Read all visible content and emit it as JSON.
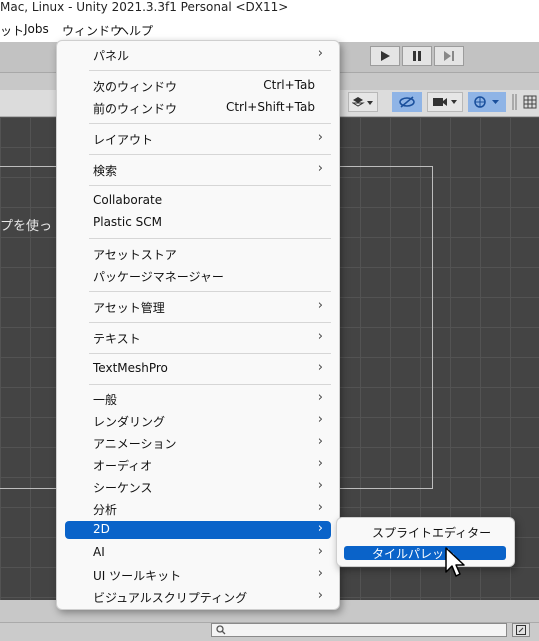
{
  "window": {
    "title": "Mac, Linux - Unity 2021.3.3f1 Personal <DX11>"
  },
  "menubar": {
    "items": [
      {
        "label": "ット"
      },
      {
        "label": "Jobs"
      },
      {
        "label": "ウィンドウ"
      },
      {
        "label": "ヘルプ"
      }
    ]
  },
  "scene": {
    "overlay_text": "プを使っ"
  },
  "window_menu": {
    "items": [
      {
        "label": "パネル",
        "arrow": "›"
      },
      {
        "label": "次のウィンドウ",
        "shortcut": "Ctrl+Tab"
      },
      {
        "label": "前のウィンドウ",
        "shortcut": "Ctrl+Shift+Tab"
      },
      {
        "label": "レイアウト",
        "arrow": "›"
      },
      {
        "label": "検索",
        "arrow": "›"
      },
      {
        "label": "Collaborate"
      },
      {
        "label": "Plastic SCM"
      },
      {
        "label": "アセットストア"
      },
      {
        "label": "パッケージマネージャー"
      },
      {
        "label": "アセット管理",
        "arrow": "›"
      },
      {
        "label": "テキスト",
        "arrow": "›"
      },
      {
        "label": "TextMeshPro",
        "arrow": "›"
      },
      {
        "label": "一般",
        "arrow": "›"
      },
      {
        "label": "レンダリング",
        "arrow": "›"
      },
      {
        "label": "アニメーション",
        "arrow": "›"
      },
      {
        "label": "オーディオ",
        "arrow": "›"
      },
      {
        "label": "シーケンス",
        "arrow": "›"
      },
      {
        "label": "分析",
        "arrow": "›"
      },
      {
        "label": "2D",
        "arrow": "›"
      },
      {
        "label": "AI",
        "arrow": "›"
      },
      {
        "label": "UI ツールキット",
        "arrow": "›"
      },
      {
        "label": "ビジュアルスクリプティング",
        "arrow": "›"
      }
    ],
    "selected": "2D"
  },
  "submenu_2d": {
    "items": [
      {
        "label": "スプライトエディター"
      },
      {
        "label": "タイルパレット"
      }
    ],
    "selected": "タイルパレット"
  },
  "icons": {
    "play": "play-icon",
    "pause": "pause-icon",
    "step": "step-icon",
    "search": "search-icon",
    "cursor": "mouse-pointer-icon"
  },
  "colors": {
    "selection": "#0a63c9",
    "scene_bg": "#444444",
    "menu_bg": "#f9f9f9"
  }
}
